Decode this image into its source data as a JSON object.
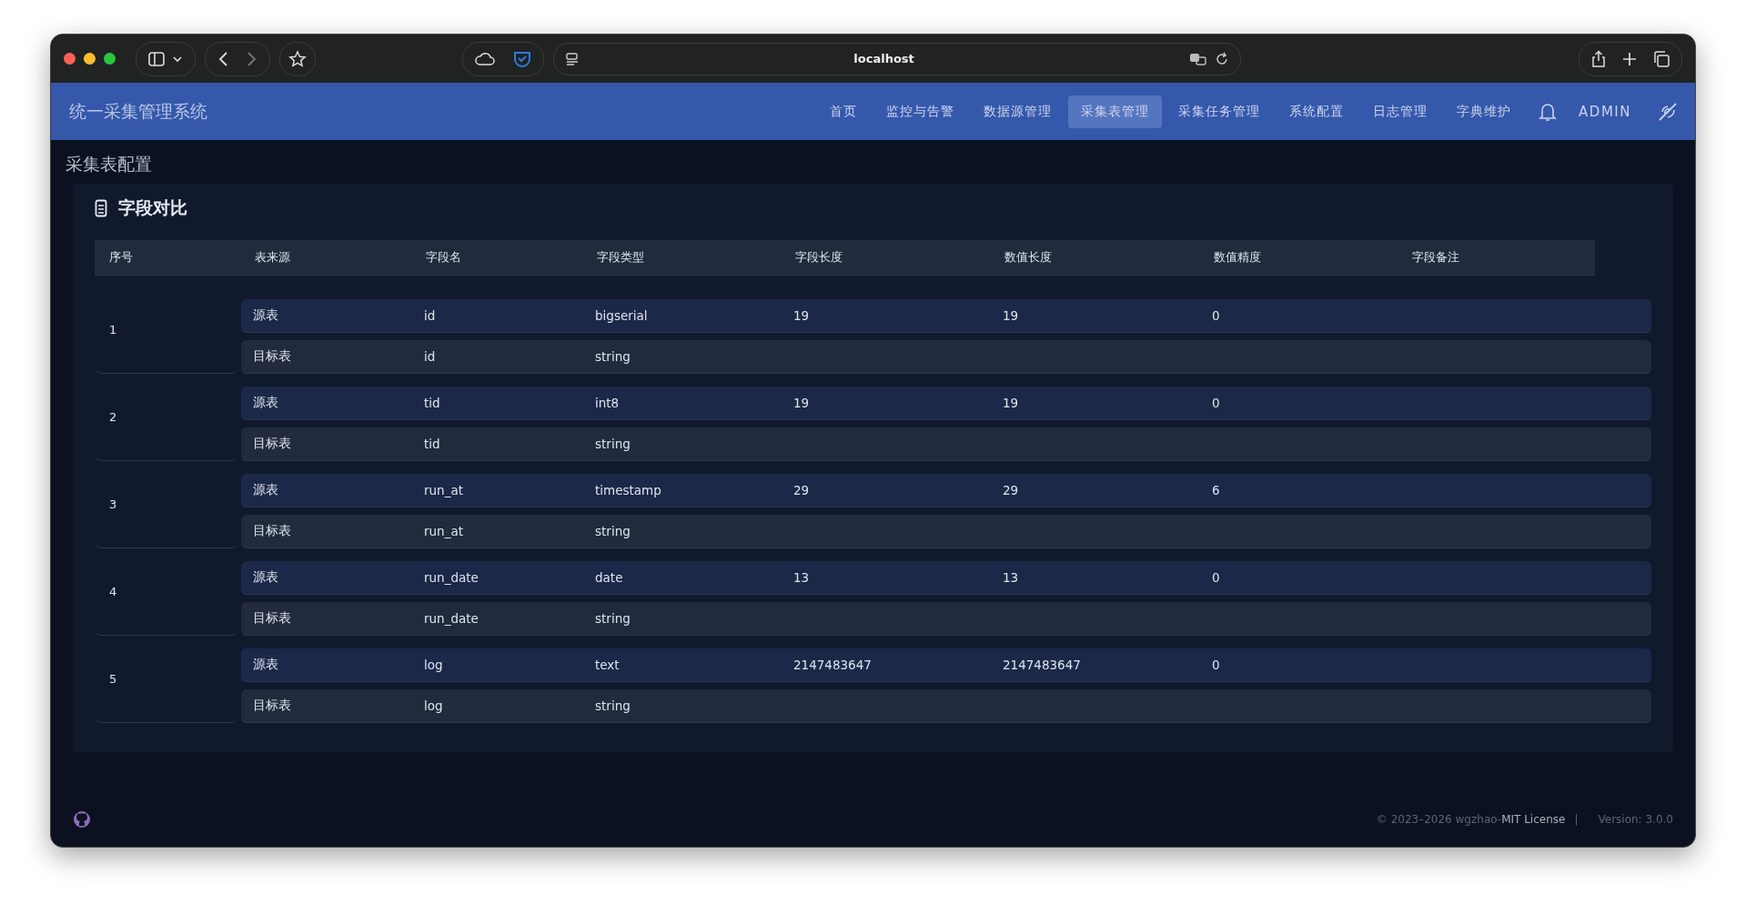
{
  "browser": {
    "url": "localhost"
  },
  "app": {
    "title": "统一采集管理系统",
    "nav": [
      {
        "label": "首页",
        "selected": false
      },
      {
        "label": "监控与告警",
        "selected": false
      },
      {
        "label": "数据源管理",
        "selected": false
      },
      {
        "label": "采集表管理",
        "selected": true
      },
      {
        "label": "采集任务管理",
        "selected": false
      },
      {
        "label": "系统配置",
        "selected": false
      },
      {
        "label": "日志管理",
        "selected": false
      },
      {
        "label": "字典维护",
        "selected": false
      }
    ],
    "user": "ADMIN"
  },
  "page_title": "采集表配置",
  "dialog": {
    "title": "字段对比",
    "columns": [
      "序号",
      "表来源",
      "字段名",
      "字段类型",
      "字段长度",
      "数值长度",
      "数值精度",
      "字段备注"
    ],
    "groups": [
      {
        "index": "1",
        "rows": [
          {
            "kind": "source",
            "source": "源表",
            "name": "id",
            "type": "bigserial",
            "length": "19",
            "num_length": "19",
            "precision": "0"
          },
          {
            "kind": "target",
            "source": "目标表",
            "name": "id",
            "type": "string"
          }
        ]
      },
      {
        "index": "2",
        "rows": [
          {
            "kind": "source",
            "source": "源表",
            "name": "tid",
            "type": "int8",
            "length": "19",
            "num_length": "19",
            "precision": "0"
          },
          {
            "kind": "target",
            "source": "目标表",
            "name": "tid",
            "type": "string"
          }
        ]
      },
      {
        "index": "3",
        "rows": [
          {
            "kind": "source",
            "source": "源表",
            "name": "run_at",
            "type": "timestamp",
            "length": "29",
            "num_length": "29",
            "precision": "6"
          },
          {
            "kind": "target",
            "source": "目标表",
            "name": "run_at",
            "type": "string"
          }
        ]
      },
      {
        "index": "4",
        "rows": [
          {
            "kind": "source",
            "source": "源表",
            "name": "run_date",
            "type": "date",
            "length": "13",
            "num_length": "13",
            "precision": "0"
          },
          {
            "kind": "target",
            "source": "目标表",
            "name": "run_date",
            "type": "string"
          }
        ]
      },
      {
        "index": "5",
        "rows": [
          {
            "kind": "source",
            "source": "源表",
            "name": "log",
            "type": "text",
            "length": "2147483647",
            "num_length": "2147483647",
            "precision": "0"
          },
          {
            "kind": "target",
            "source": "目标表",
            "name": "log",
            "type": "string"
          }
        ]
      }
    ]
  },
  "footer": {
    "copyright": "© 2023–2026 wgzhao-",
    "license": "MIT License",
    "separator": "|",
    "version": "Version: 3.0.0"
  }
}
